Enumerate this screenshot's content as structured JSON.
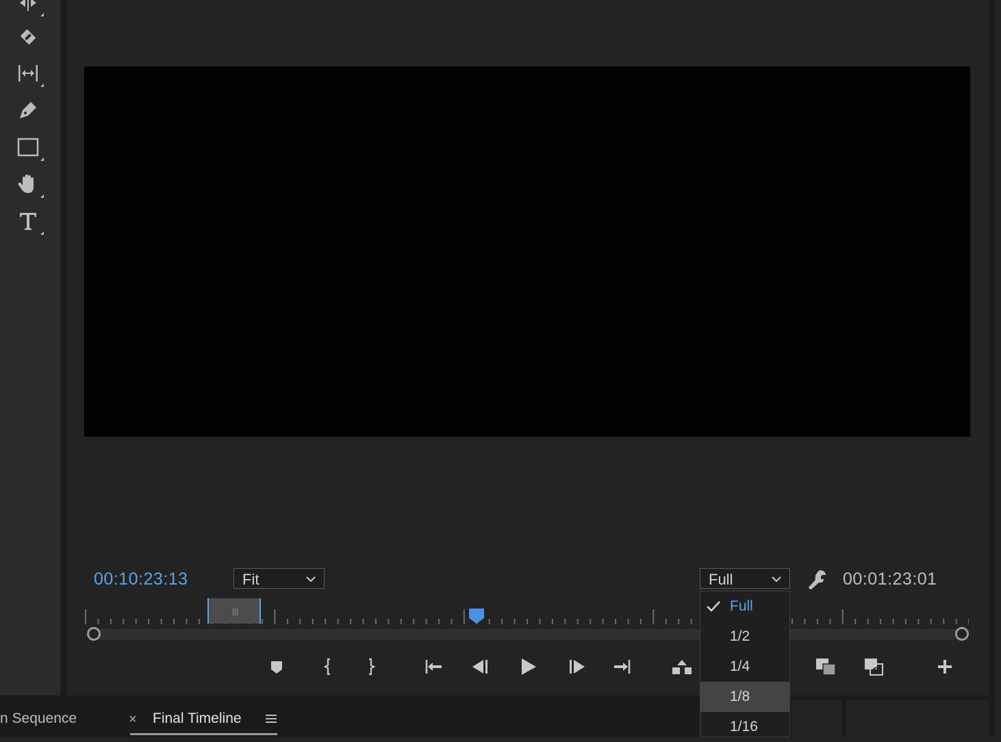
{
  "monitor": {
    "current_timecode": "00:10:23:13",
    "duration_timecode": "00:01:23:01",
    "zoom_select": "Fit",
    "resolution_select": "Full"
  },
  "resolution_dropdown": {
    "options": [
      "Full",
      "1/2",
      "1/4",
      "1/8",
      "1/16"
    ],
    "selected": "Full",
    "hovered": "1/8"
  },
  "tools": [
    "track-select-tool-icon",
    "razor-tool-icon",
    "slip-tool-icon",
    "pen-tool-icon",
    "rectangle-tool-icon",
    "hand-tool-icon",
    "type-tool-icon"
  ],
  "tabs": {
    "partial_tab_label": "n Sequence",
    "close_symbol": "×",
    "active_tab_label": "Final Timeline"
  },
  "colors": {
    "accent_blue": "#5aa2ea",
    "panel_bg": "#232323",
    "video_bg": "#000000"
  }
}
